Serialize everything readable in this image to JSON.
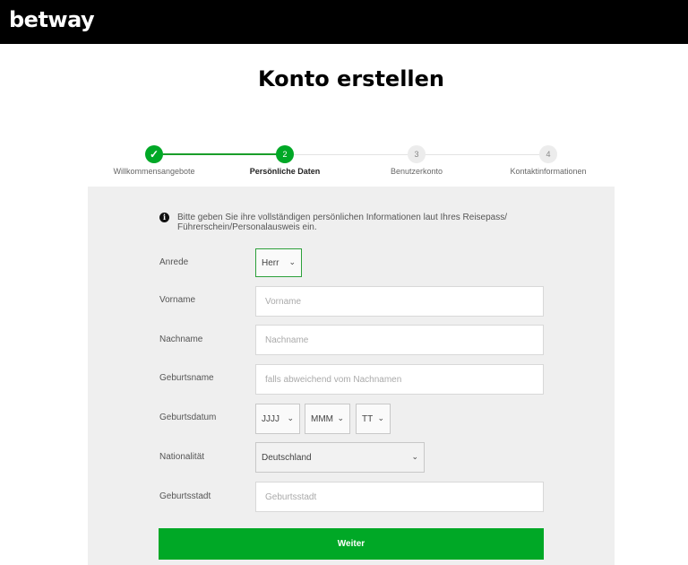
{
  "header": {
    "logo": "betway"
  },
  "page": {
    "title": "Konto erstellen"
  },
  "steps": [
    {
      "number": "✓",
      "label": "Willkommensangebote",
      "state": "done"
    },
    {
      "number": "2",
      "label": "Persönliche Daten",
      "state": "active"
    },
    {
      "number": "3",
      "label": "Benutzerkonto",
      "state": "todo"
    },
    {
      "number": "4",
      "label": "Kontaktinformationen",
      "state": "todo"
    }
  ],
  "info": {
    "icon": "info-icon",
    "icon_glyph": "i",
    "text": "Bitte geben Sie ihre vollständigen persönlichen Informationen laut Ihres Reisepass/ Führerschein/Personalausweis ein."
  },
  "form": {
    "anrede": {
      "label": "Anrede",
      "value": "Herr"
    },
    "vorname": {
      "label": "Vorname",
      "placeholder": "Vorname"
    },
    "nachname": {
      "label": "Nachname",
      "placeholder": "Nachname"
    },
    "geburtsname": {
      "label": "Geburtsname",
      "placeholder": "falls abweichend vom Nachnamen"
    },
    "geburtsdatum": {
      "label": "Geburtsdatum",
      "year": "JJJJ",
      "month": "MMM",
      "day": "TT"
    },
    "nationalitaet": {
      "label": "Nationalität",
      "value": "Deutschland"
    },
    "geburtsstadt": {
      "label": "Geburtsstadt",
      "placeholder": "Geburtsstadt"
    }
  },
  "actions": {
    "next_label": "Weiter"
  },
  "colors": {
    "accent": "#00a826",
    "header_bg": "#000000",
    "panel_bg": "#efefef"
  }
}
